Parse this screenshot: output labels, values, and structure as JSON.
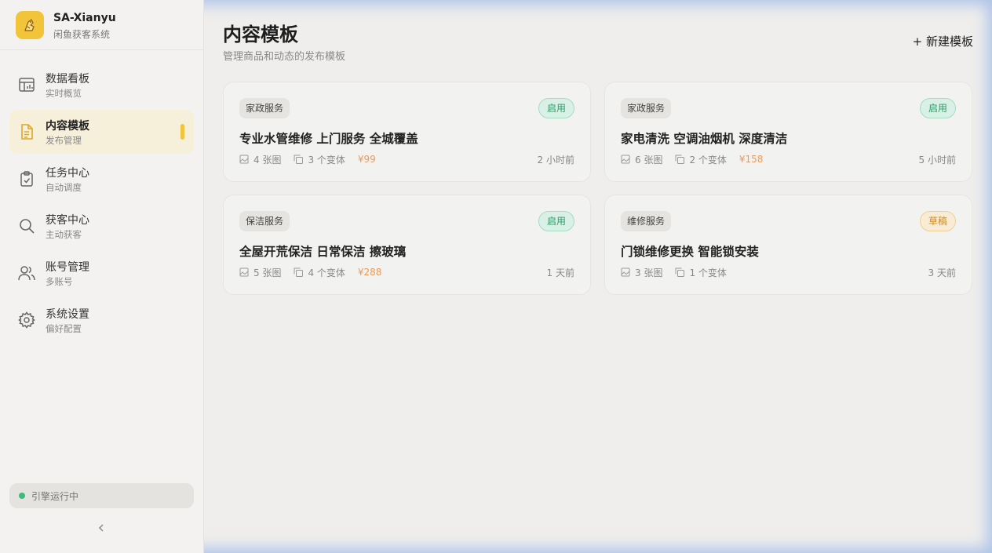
{
  "brand": {
    "name": "SA-Xianyu",
    "subtitle": "闲鱼获客系统"
  },
  "sidebar": {
    "items": [
      {
        "label": "数据看板",
        "sub": "实时概览",
        "icon": "dashboard-icon"
      },
      {
        "label": "内容模板",
        "sub": "发布管理",
        "icon": "document-icon",
        "active": true
      },
      {
        "label": "任务中心",
        "sub": "自动调度",
        "icon": "clipboard-check-icon"
      },
      {
        "label": "获客中心",
        "sub": "主动获客",
        "icon": "search-icon"
      },
      {
        "label": "账号管理",
        "sub": "多账号",
        "icon": "users-icon"
      },
      {
        "label": "系统设置",
        "sub": "偏好配置",
        "icon": "gear-icon"
      }
    ],
    "status": "引擎运行中"
  },
  "main": {
    "title": "内容模板",
    "subtitle": "管理商品和动态的发布模板",
    "new_button": "+ 新建模板"
  },
  "cards": [
    {
      "tag": "家政服务",
      "status": "启用",
      "title": "专业水管维修 上门服务 全城覆盖",
      "images": "4 张图",
      "variants": "3 个变体",
      "price": "¥99",
      "time": "2 小时前"
    },
    {
      "tag": "家政服务",
      "status": "启用",
      "title": "家电清洗 空调油烟机 深度清洁",
      "images": "6 张图",
      "variants": "2 个变体",
      "price": "¥158",
      "time": "5 小时前"
    },
    {
      "tag": "保洁服务",
      "status": "启用",
      "title": "全屋开荒保洁 日常保洁 擦玻璃",
      "images": "5 张图",
      "variants": "4 个变体",
      "price": "¥288",
      "time": "1 天前"
    },
    {
      "tag": "维修服务",
      "status": "草稿",
      "title": "门锁维修更换 智能锁安装",
      "images": "3 张图",
      "variants": "1 个变体",
      "price": "",
      "time": "3 天前"
    }
  ],
  "colors": {
    "accent": "#f2c43a",
    "enabled": "#2d9c66",
    "draft": "#d08a1d",
    "price": "#e99b5a",
    "engine_dot": "#3dbb7a"
  }
}
